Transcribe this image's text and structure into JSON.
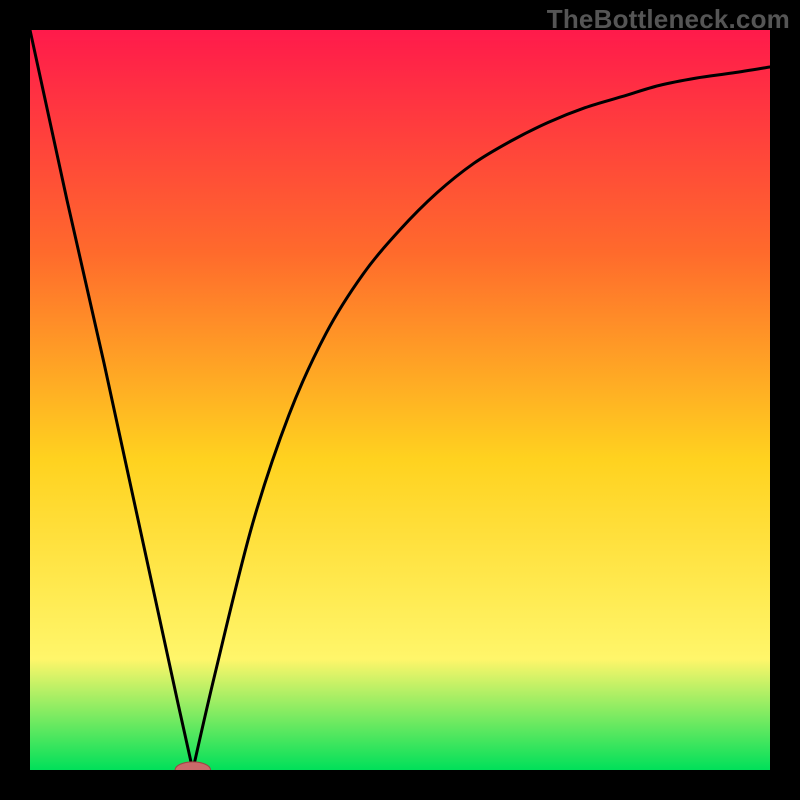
{
  "watermark": "TheBottleneck.com",
  "colors": {
    "top": "#ff1a4b",
    "mid_upper": "#ff6a2c",
    "mid": "#ffd21f",
    "mid_lower": "#fff66a",
    "bottom": "#00e05a",
    "curve": "#000000",
    "marker_fill": "#c96a6a",
    "marker_stroke": "#a04444",
    "frame": "#000000"
  },
  "chart_data": {
    "type": "line",
    "title": "",
    "xlabel": "",
    "ylabel": "",
    "xlim": [
      0,
      100
    ],
    "ylim": [
      0,
      100
    ],
    "notes": "No tick labels or axis labels are rendered. Background is a vertical red→yellow→green gradient. A black V/sweep curve dips to ~0 near x≈22 with a small rounded marker at the minimum.",
    "series": [
      {
        "name": "curve",
        "x": [
          0,
          5,
          10,
          15,
          20,
          22,
          25,
          30,
          35,
          40,
          45,
          50,
          55,
          60,
          65,
          70,
          75,
          80,
          85,
          90,
          95,
          100
        ],
        "y": [
          100,
          77,
          55,
          32,
          9,
          0,
          13,
          33,
          48,
          59,
          67,
          73,
          78,
          82,
          85,
          87.5,
          89.5,
          91,
          92.5,
          93.5,
          94.2,
          95
        ]
      }
    ],
    "marker": {
      "x": 22,
      "y": 0,
      "rx": 2.4,
      "ry": 1.1
    }
  }
}
